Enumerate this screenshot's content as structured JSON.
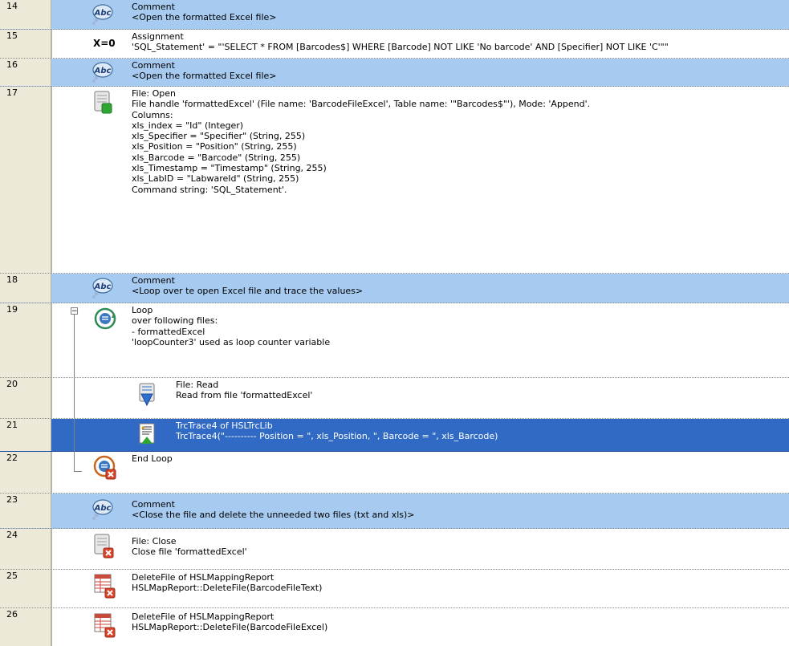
{
  "rows": [
    {
      "num": "14",
      "lines": [
        "Comment",
        "<Open the formatted Excel file>"
      ],
      "icon": "abc-comment-icon"
    },
    {
      "num": "15",
      "lines": [
        "Assignment",
        "'SQL_Statement' = \"'SELECT * FROM [Barcodes$] WHERE [Barcode] NOT LIKE 'No barcode' AND [Specifier] NOT LIKE 'C'\"\""
      ],
      "icon": "assignment-x0-icon"
    },
    {
      "num": "16",
      "lines": [
        "Comment",
        "<Open the formatted Excel file>"
      ],
      "icon": "abc-comment-icon"
    },
    {
      "num": "17",
      "lines": [
        "File: Open",
        "File handle 'formattedExcel' (File name: 'BarcodeFileExcel',  Table name: '\"Barcodes$\"'),  Mode: 'Append'.",
        "Columns:",
        "xls_index = \"Id\" (Integer)",
        "xls_Specifier = \"Specifier\" (String, 255)",
        "xls_Position = \"Position\" (String, 255)",
        "xls_Barcode = \"Barcode\" (String, 255)",
        "xls_Timestamp = \"Timestamp\" (String, 255)",
        "xls_LabID = \"LabwareId\" (String, 255)",
        "Command string: 'SQL_Statement'."
      ],
      "icon": "file-open-icon"
    },
    {
      "num": "18",
      "lines": [
        "Comment",
        "<Loop over te open Excel file and trace the values>"
      ],
      "icon": "abc-comment-icon"
    },
    {
      "num": "19",
      "lines": [
        "Loop",
        "over following files:",
        "- formattedExcel",
        "'loopCounter3' used as loop counter variable"
      ],
      "icon": "loop-icon"
    },
    {
      "num": "20",
      "lines": [
        "File: Read",
        "Read from file 'formattedExcel'"
      ],
      "icon": "file-read-icon"
    },
    {
      "num": "21",
      "lines": [
        "TrcTrace4 of HSLTrcLib",
        "TrcTrace4(\"---------- Position = \", xls_Position, \",   Barcode = \", xls_Barcode)"
      ],
      "icon": "trace-icon"
    },
    {
      "num": "22",
      "lines": [
        "End Loop"
      ],
      "icon": "end-loop-icon"
    },
    {
      "num": "23",
      "lines": [
        "Comment",
        "<Close the file and delete the unneeded two files (txt and xls)>"
      ],
      "icon": "abc-comment-icon"
    },
    {
      "num": "24",
      "lines": [
        "File: Close",
        "Close file 'formattedExcel'"
      ],
      "icon": "file-close-icon"
    },
    {
      "num": "25",
      "lines": [
        "DeleteFile of HSLMappingReport",
        "HSLMapReport::DeleteFile(BarcodeFileText)"
      ],
      "icon": "delete-file-icon"
    },
    {
      "num": "26",
      "lines": [
        "DeleteFile of HSLMappingReport",
        "HSLMapReport::DeleteFile(BarcodeFileExcel)"
      ],
      "icon": "delete-file-icon"
    }
  ],
  "assignment_icon_text": "X=0",
  "abc_icon_text": "Abc",
  "collapse_symbol": "−",
  "colors": {
    "comment_row": "#a6caf0",
    "selected_row": "#316ac5",
    "gutter": "#ece9d8"
  }
}
